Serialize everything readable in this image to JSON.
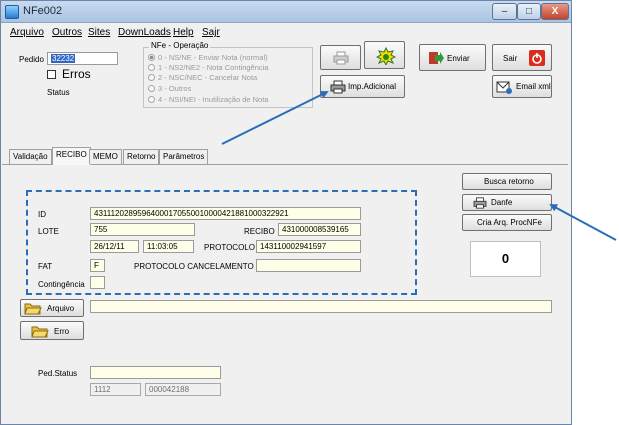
{
  "window": {
    "title": "NFe002",
    "min": "–",
    "max": "□",
    "close": "X"
  },
  "menu": [
    "Arquivo",
    "Outros",
    "Sites",
    "DownLoads",
    "Help",
    "Sajr"
  ],
  "header": {
    "pedido_label": "Pedido",
    "pedido_value": "32232",
    "erros_label": "Erros",
    "status_label": "Status"
  },
  "operacao": {
    "title": "NFe - Operação",
    "options": [
      "0 - NS/NE - Enviar Nota (normal)",
      "1 - NS2/NE2 - Nota Contingência",
      "2 - NSC/NEC - Cancelar Nota",
      "3 - Outros",
      "4 - NSI/NEI - Inutilização de Nota"
    ],
    "selected": 0
  },
  "buttons": {
    "imp_adicional": "Imp.Adicional",
    "enviar": "Enviar",
    "sair": "Sair",
    "email_xml": "Email xml",
    "busca_retorno": "Busca retorno",
    "danfe": "Danfe",
    "cria_arq": "Cria Arq. ProcNFe",
    "arquivo": "Arquivo",
    "erro": "Erro"
  },
  "tabs": [
    "Validação",
    "RECIBO",
    "MEMO",
    "Retorno",
    "Parâmetros"
  ],
  "active_tab": "RECIBO",
  "recibo": {
    "id_label": "ID",
    "id_value": "43111202895964000170550010000421881000322921",
    "lote_label": "LOTE",
    "lote_value": "755",
    "recibo_label": "RECIBO",
    "recibo_value": "431000008539165",
    "date_value": "26/12/11",
    "time_value": "11:03:05",
    "protocolo_label": "PROTOCOLO",
    "protocolo_value": "143110002941597",
    "fat_label": "FAT",
    "fat_value": "F",
    "protocolo_cancel_label": "PROTOCOLO CANCELAMENTO",
    "protocolo_cancel_value": "",
    "contingencia_label": "Contingência",
    "contingencia_value": ""
  },
  "counter": "0",
  "ped_status": {
    "label": "Ped.Status",
    "value": "",
    "code1": "1112",
    "code2": "000042188"
  },
  "colors": {
    "annotation": "#2a6fb6",
    "field_bg": "#fffee8",
    "selection": "#3166c6"
  }
}
